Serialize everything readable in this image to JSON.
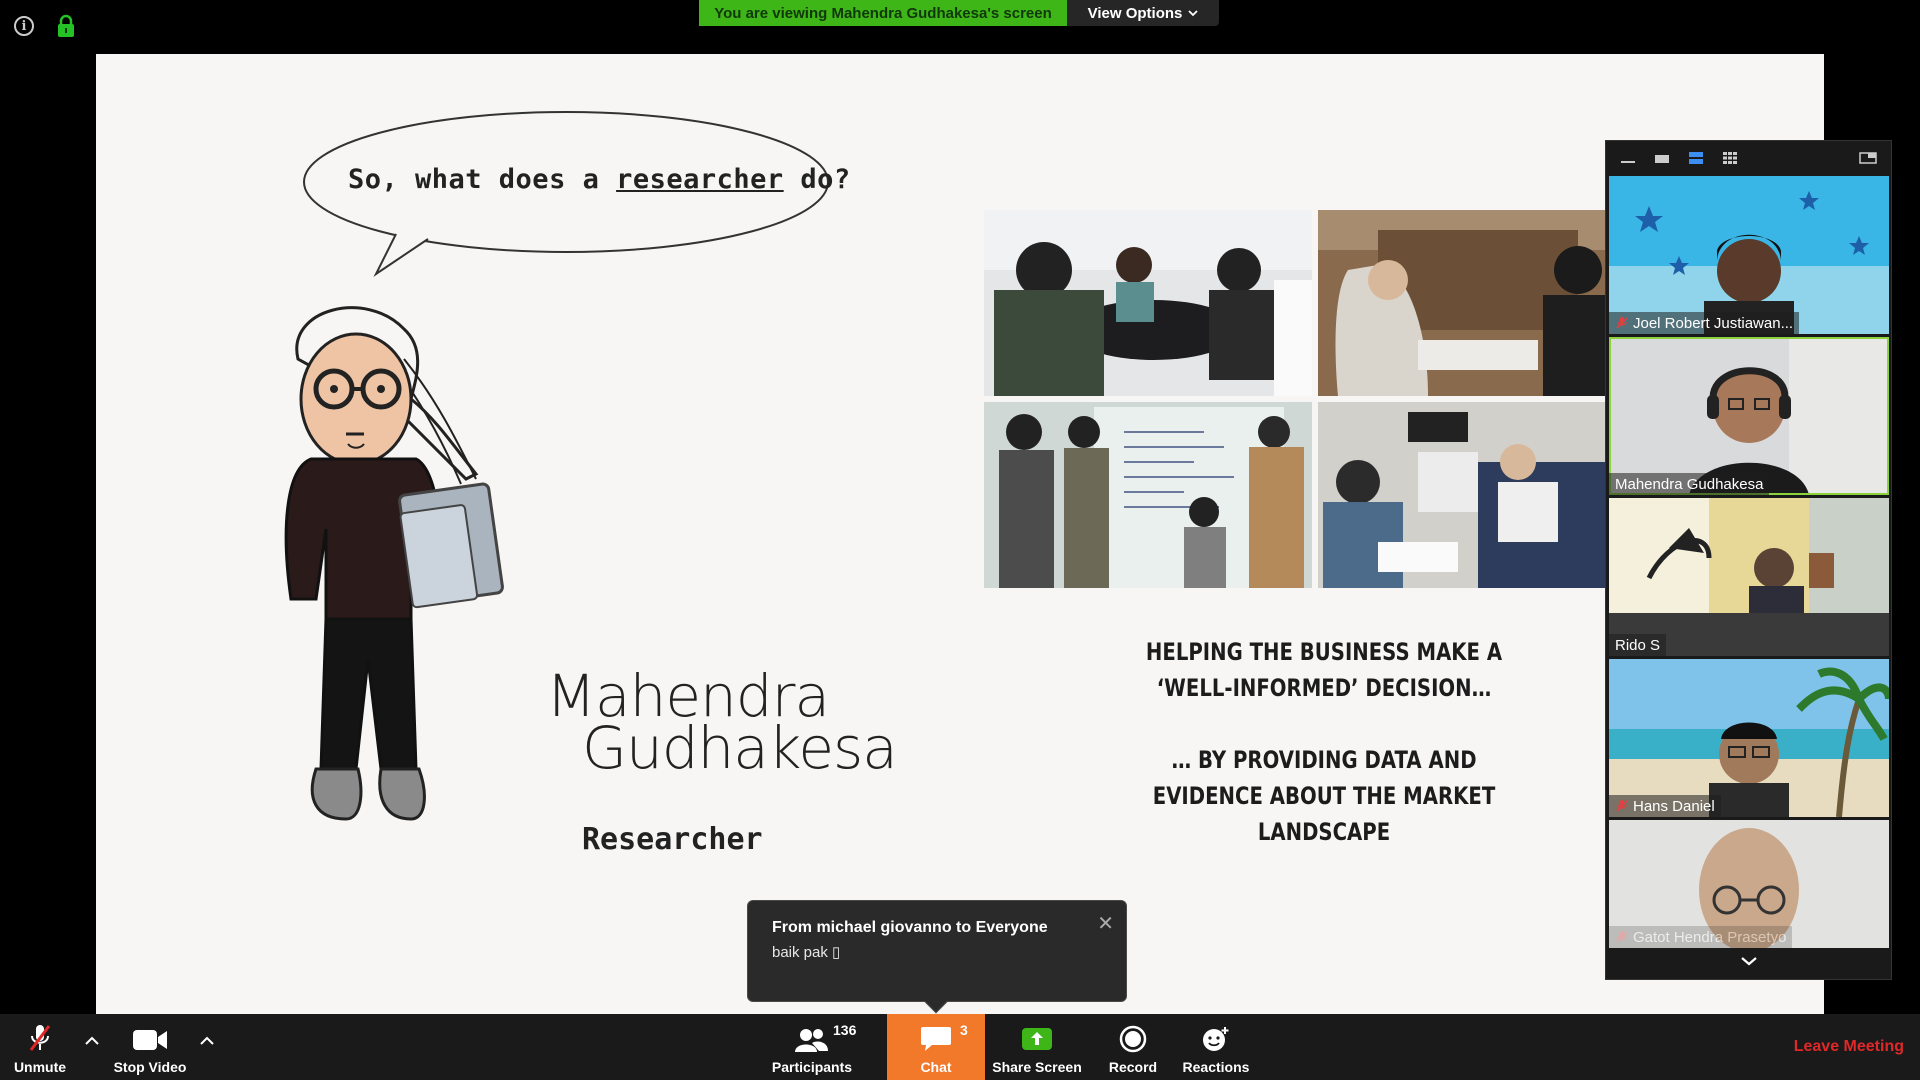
{
  "banner": {
    "viewing_text": "You are viewing Mahendra Gudhakesa's screen",
    "view_options_label": "View Options"
  },
  "slide": {
    "question_prefix": "So, what does a ",
    "question_underlined": "researcher",
    "question_suffix": " do?",
    "name_line1": "Mahendra",
    "name_line2": "Gudhakesa",
    "role": "Researcher",
    "tagline_1": "HELPING THE BUSINESS MAKE A ‘WELL-INFORMED’ DECISION…",
    "tagline_2": "… BY PROVIDING DATA AND EVIDENCE ABOUT THE MARKET LANDSCAPE"
  },
  "gallery": {
    "participants": [
      {
        "name": "Joel Robert Justiawan...",
        "muted": true
      },
      {
        "name": "Mahendra Gudhakesa",
        "muted": false
      },
      {
        "name": "Rido S",
        "muted": false
      },
      {
        "name": "Hans Daniel",
        "muted": true
      },
      {
        "name": "Gatot Hendra Prasetyo",
        "muted": true
      }
    ]
  },
  "chat_toast": {
    "from": "From michael giovanno to Everyone",
    "message": "baik  pak ▯"
  },
  "toolbar": {
    "unmute_label": "Unmute",
    "stop_video_label": "Stop Video",
    "participants_label": "Participants",
    "participants_count": "136",
    "chat_label": "Chat",
    "chat_count": "3",
    "share_screen_label": "Share Screen",
    "record_label": "Record",
    "reactions_label": "Reactions",
    "leave_label": "Leave Meeting"
  },
  "colors": {
    "banner_green": "#3fb618",
    "chat_orange": "#f2782a",
    "leave_red": "#e02828",
    "active_speaker": "#8bd23c"
  }
}
